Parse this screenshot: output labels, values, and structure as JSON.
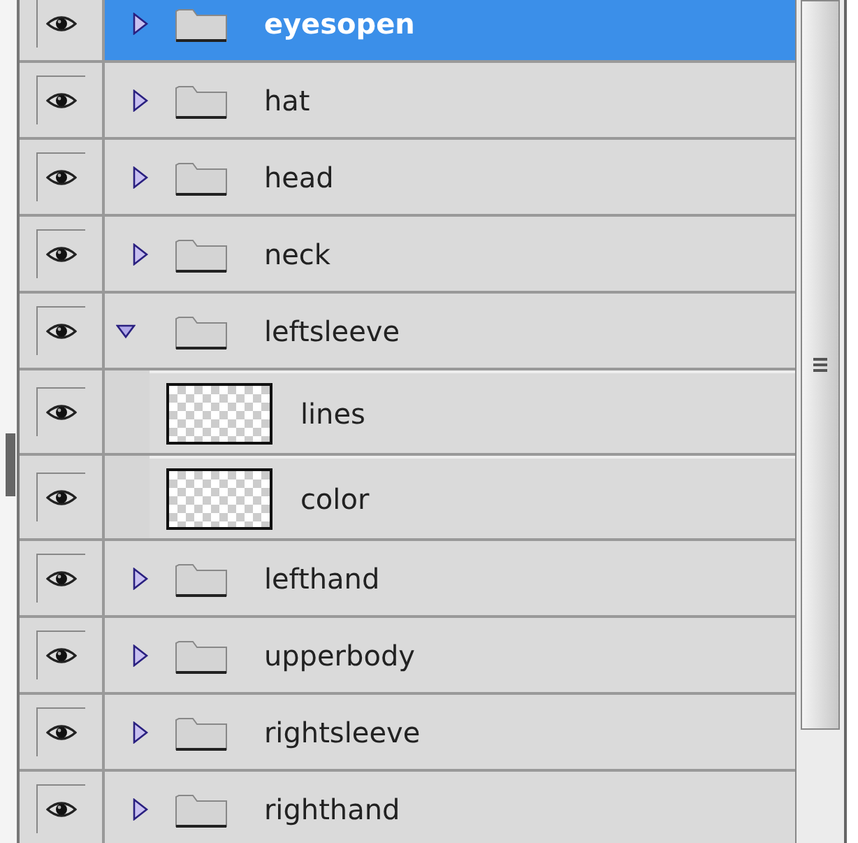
{
  "layers": [
    {
      "kind": "group",
      "name": "eyesopen",
      "visible": true,
      "selected": true,
      "expanded": false
    },
    {
      "kind": "group",
      "name": "hat",
      "visible": true,
      "selected": false,
      "expanded": false
    },
    {
      "kind": "group",
      "name": "head",
      "visible": true,
      "selected": false,
      "expanded": false
    },
    {
      "kind": "group",
      "name": "neck",
      "visible": true,
      "selected": false,
      "expanded": false
    },
    {
      "kind": "group",
      "name": "leftsleeve",
      "visible": true,
      "selected": false,
      "expanded": true,
      "children": [
        {
          "kind": "layer",
          "name": "lines",
          "visible": true,
          "selected": false
        },
        {
          "kind": "layer",
          "name": "color",
          "visible": true,
          "selected": false
        }
      ]
    },
    {
      "kind": "group",
      "name": "lefthand",
      "visible": true,
      "selected": false,
      "expanded": false
    },
    {
      "kind": "group",
      "name": "upperbody",
      "visible": true,
      "selected": false,
      "expanded": false
    },
    {
      "kind": "group",
      "name": "rightsleeve",
      "visible": true,
      "selected": false,
      "expanded": false
    },
    {
      "kind": "group",
      "name": "righthand",
      "visible": true,
      "selected": false,
      "expanded": false
    }
  ]
}
